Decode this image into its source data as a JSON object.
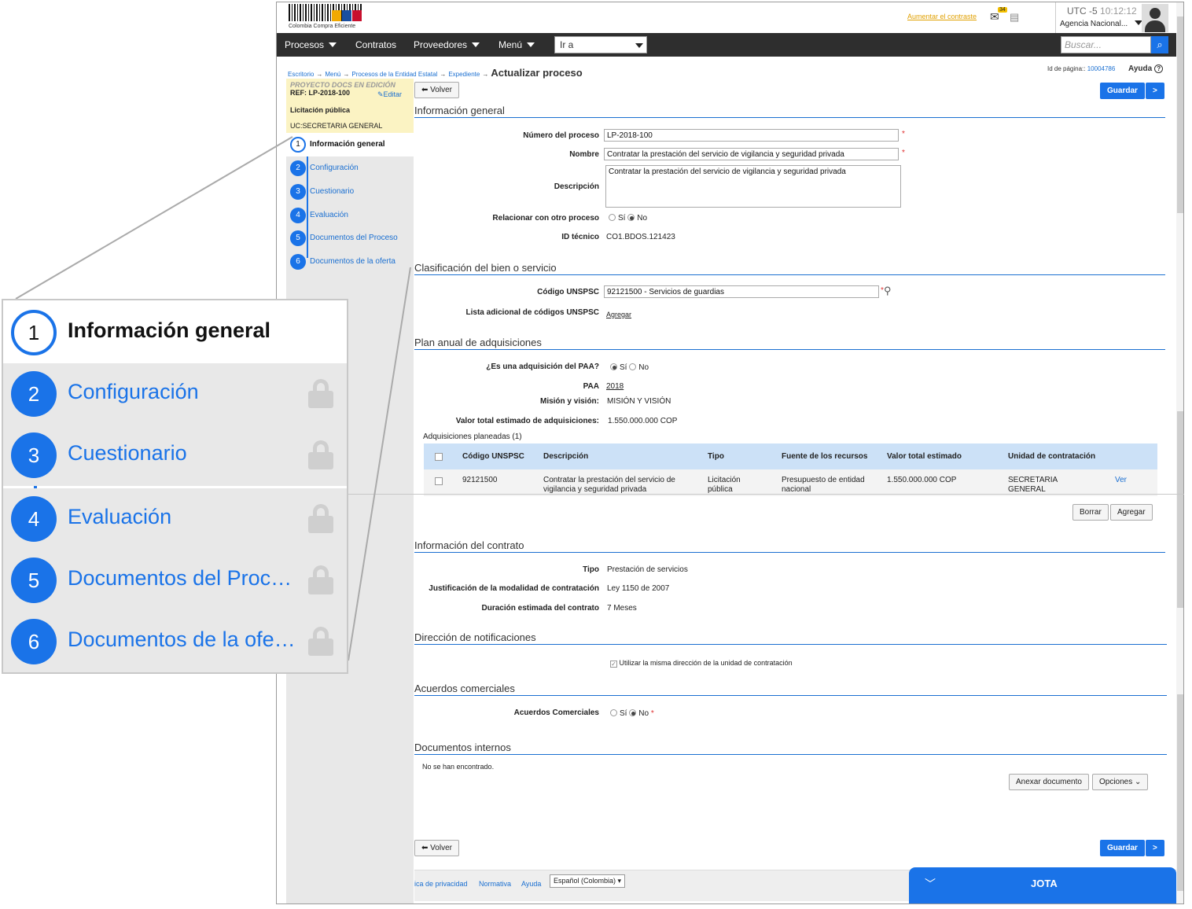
{
  "brand": {
    "logo_caption": "Colombia Compra Eficiente"
  },
  "header": {
    "contrast_link": "Aumentar el contraste",
    "mail_count": "34",
    "timezone": "UTC -5",
    "time": "10:12:12",
    "agency": "Agencia Nacional..."
  },
  "nav": {
    "items": [
      "Procesos",
      "Contratos",
      "Proveedores",
      "Menú"
    ],
    "goto": "Ir a",
    "search_placeholder": "Buscar..."
  },
  "breadcrumb": {
    "items": [
      "Escritorio",
      "Menú",
      "Procesos de la Entidad Estatal",
      "Expediente"
    ],
    "current": "Actualizar proceso"
  },
  "page_id": {
    "label": "Id de página::",
    "value": "10004786"
  },
  "help": "Ayuda",
  "project": {
    "status": "PROYECTO DOCS EN EDICIÓN",
    "ref": "REF: LP-2018-100",
    "edit": "Editar",
    "type": "Licitación pública",
    "uc": "UC:SECRETARIA GENERAL"
  },
  "steps": [
    {
      "num": "1",
      "label": "Información general"
    },
    {
      "num": "2",
      "label": "Configuración"
    },
    {
      "num": "3",
      "label": "Cuestionario"
    },
    {
      "num": "4",
      "label": "Evaluación"
    },
    {
      "num": "5",
      "label": "Documentos del Proceso"
    },
    {
      "num": "6",
      "label": "Documentos de la oferta"
    }
  ],
  "zoom_steps": [
    {
      "num": "1",
      "label": "Información general"
    },
    {
      "num": "2",
      "label": "Configuración"
    },
    {
      "num": "3",
      "label": "Cuestionario"
    },
    {
      "num": "4",
      "label": "Evaluación"
    },
    {
      "num": "5",
      "label": "Documentos del Proc…"
    },
    {
      "num": "6",
      "label": "Documentos de la ofe…"
    }
  ],
  "buttons": {
    "back": "Volver",
    "save": "Guardar",
    "next": ">",
    "delete": "Borrar",
    "add": "Agregar",
    "attach": "Anexar documento",
    "options": "Opciones"
  },
  "general": {
    "title": "Información general",
    "process_number_label": "Número del proceso",
    "process_number": "LP-2018-100",
    "name_label": "Nombre",
    "name": "Contratar la prestación del servicio de vigilancia y seguridad privada",
    "desc_label": "Descripción",
    "desc": "Contratar la prestación del servicio de vigilancia y seguridad privada",
    "relate_label": "Relacionar con otro proceso",
    "yes": "Sí",
    "no": "No",
    "tech_id_label": "ID técnico",
    "tech_id": "CO1.BDOS.121423"
  },
  "classification": {
    "title": "Clasificación del bien o servicio",
    "code_label": "Código UNSPSC",
    "code": "92121500 - Servicios de guardias",
    "extra_label": "Lista adicional de códigos UNSPSC",
    "extra_link": "Agregar"
  },
  "paa": {
    "title": "Plan anual de adquisiciones",
    "is_paa_label": "¿Es una adquisición del PAA?",
    "paa_label": "PAA",
    "paa_value": "2018",
    "mission_label": "Misión y visión:",
    "mission": "MISIÓN Y VISIÓN",
    "total_label": "Valor total estimado de adquisiciones:",
    "total": "1.550.000.000 COP",
    "planned": "Adquisiciones planeadas (1)",
    "columns": [
      "Código UNSPSC",
      "Descripción",
      "Tipo",
      "Fuente de los recursos",
      "Valor total estimado",
      "Unidad de contratación"
    ],
    "rows": [
      {
        "code": "92121500",
        "desc": "Contratar la prestación del servicio de vigilancia y seguridad privada",
        "type": "Licitación pública",
        "source": "Presupuesto de entidad nacional",
        "value": "1.550.000.000 COP",
        "unit": "SECRETARIA GENERAL",
        "action": "Ver"
      }
    ]
  },
  "contract": {
    "title": "Información del contrato",
    "type_label": "Tipo",
    "type": "Prestación de servicios",
    "just_label": "Justificación de la modalidad de contratación",
    "just": "Ley 1150 de 2007",
    "dur_label": "Duración estimada del contrato",
    "dur": "7 Meses"
  },
  "notif": {
    "title": "Dirección de notificaciones",
    "same": "Utilizar la misma dirección de la unidad de contratación"
  },
  "agreements": {
    "title": "Acuerdos comerciales",
    "label": "Acuerdos Comerciales"
  },
  "internal": {
    "title": "Documentos internos",
    "empty": "No se han encontrado."
  },
  "footer": {
    "privacy": "ica de privacidad",
    "norm": "Normativa",
    "help": "Ayuda",
    "lang": "Español (Colombia)"
  },
  "chat": {
    "title": "JOTA"
  }
}
